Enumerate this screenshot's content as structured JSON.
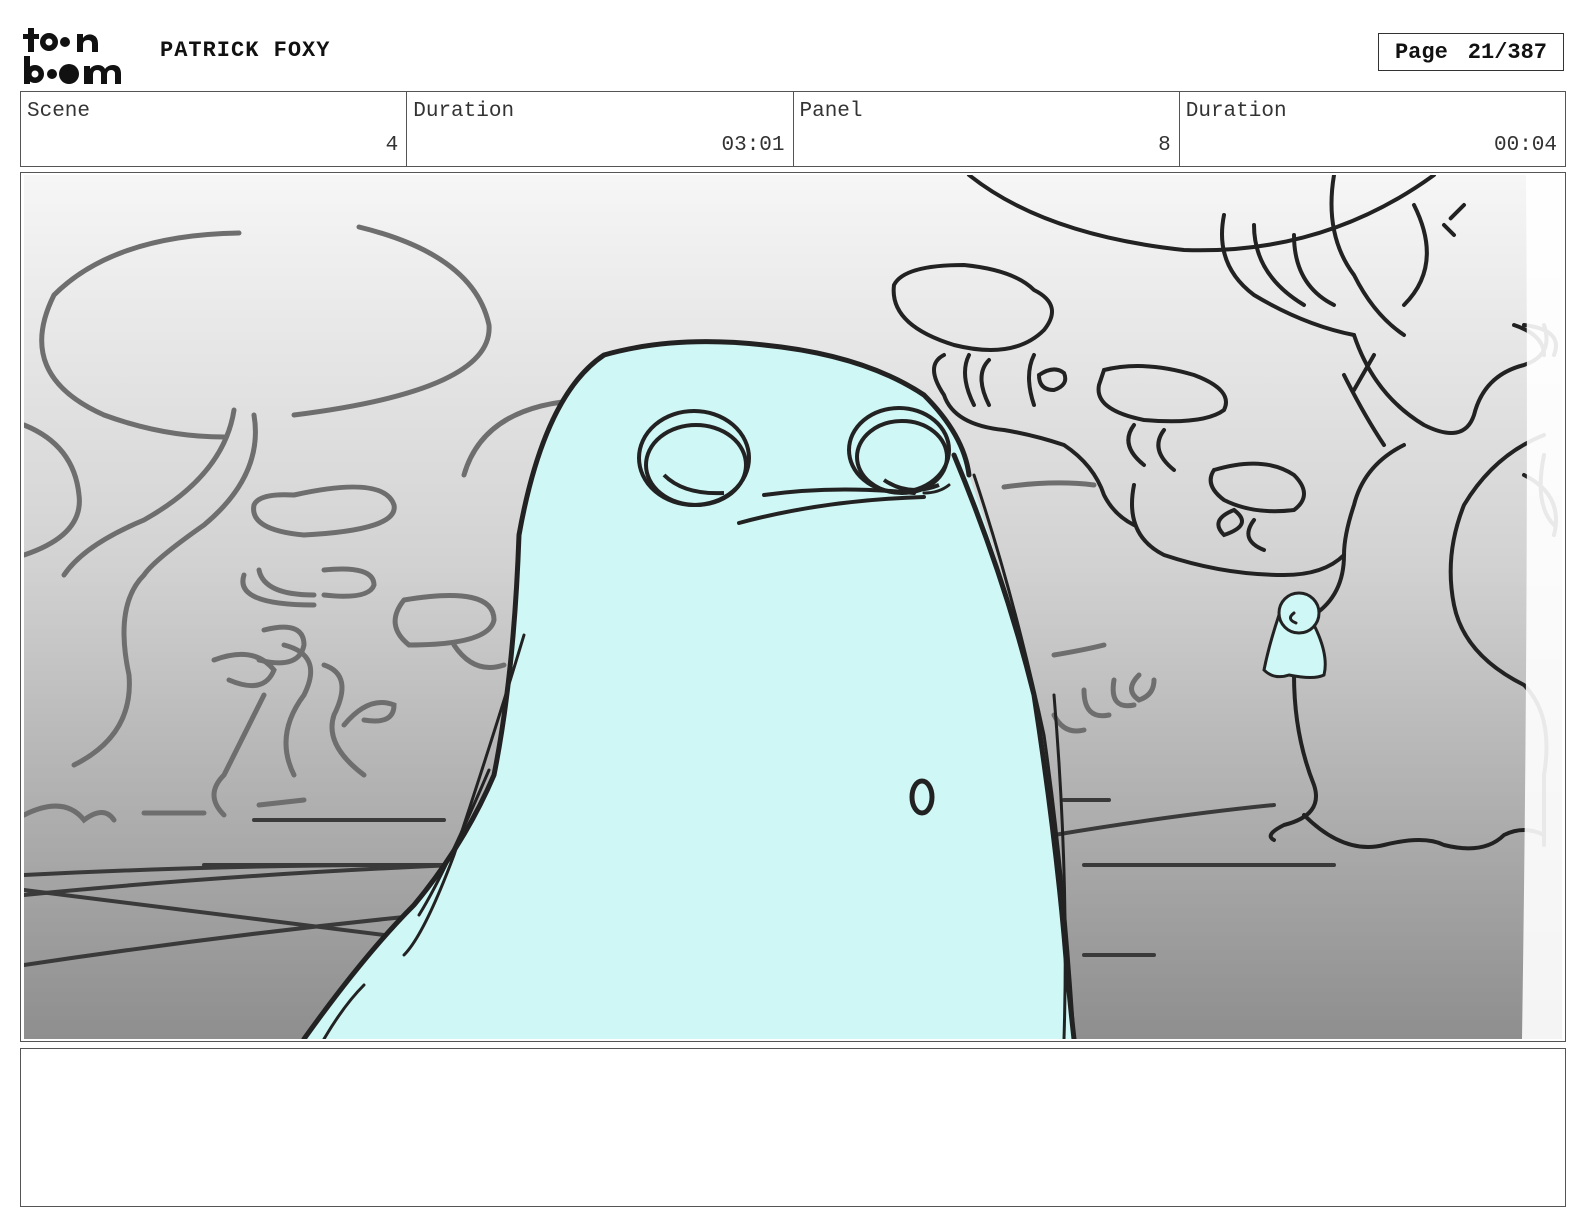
{
  "header": {
    "logo_text": "toon boom",
    "project_title": "PATRICK FOXY",
    "page_label": "Page",
    "page_number": "21/387"
  },
  "info": {
    "scene_label": "Scene",
    "scene_value": "4",
    "scene_duration_label": "Duration",
    "scene_duration_value": "03:01",
    "panel_label": "Panel",
    "panel_value": "8",
    "panel_duration_label": "Duration",
    "panel_duration_value": "00:04"
  },
  "colors": {
    "character_fill": "#cff7f5",
    "line_art": "#222222",
    "sky_top": "#f6f6f6",
    "ground_bottom": "#8e8e8e"
  },
  "notes": {
    "text": ""
  }
}
